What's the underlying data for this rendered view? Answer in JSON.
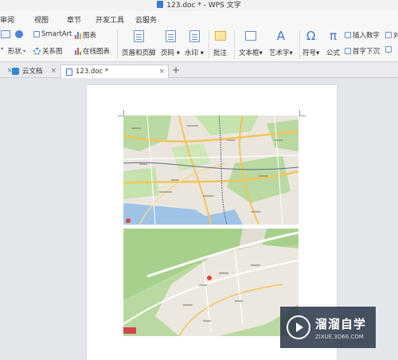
{
  "window": {
    "title": "123.doc * - WPS 文字"
  },
  "menu_tabs": [
    "审阅",
    "视图",
    "章节",
    "开发工具",
    "云服务"
  ],
  "ribbon": {
    "smartart": "SmartArt",
    "chart": "图表",
    "shape": "形状",
    "relation": "关系图",
    "online_chart": "在线图表",
    "header_footer": "页眉和页脚",
    "page_number": "页码",
    "watermark": "水印",
    "comment": "批注",
    "textbox": "文本框",
    "wordart": "艺术字",
    "symbol": "符号",
    "formula": "公式",
    "insert_number": "插入数字",
    "dropcap": "首字下沉",
    "object_partial": "对"
  },
  "doc_tabs": [
    {
      "label": "",
      "closable": true
    },
    {
      "label": "云文档",
      "closable": true
    },
    {
      "label": "123.doc *",
      "closable": true,
      "active": true
    }
  ],
  "watermark": {
    "name": "溜溜自学",
    "url": "ZIXUE.3D66.COM"
  },
  "colors": {
    "accent": "#3b78d0",
    "map_green": "#b9d9a0",
    "map_road": "#f2c55a",
    "map_water": "#9fc3e6"
  }
}
